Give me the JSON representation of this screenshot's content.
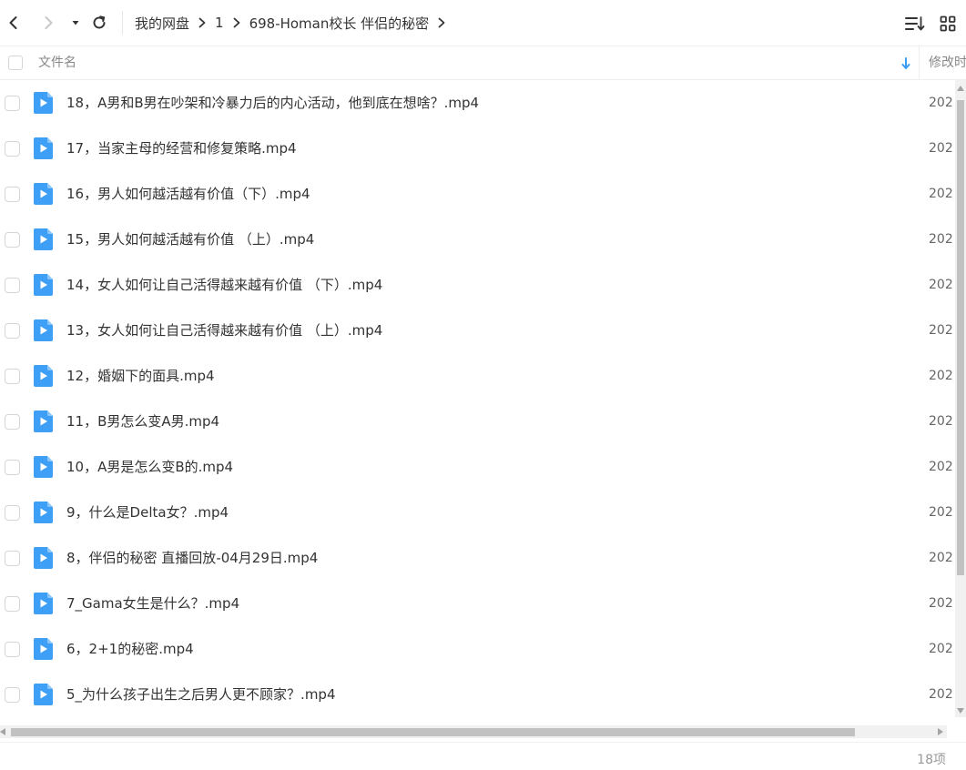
{
  "toolbar": {
    "back": "back-icon",
    "forward": "forward-icon",
    "history": "caret-down-icon",
    "refresh": "refresh-icon",
    "sort": "sort-list-icon",
    "view": "grid-view-icon"
  },
  "breadcrumb": [
    {
      "label": "我的网盘"
    },
    {
      "label": "1"
    },
    {
      "label": "698-Homan校长 伴侣的秘密"
    }
  ],
  "columns": {
    "name": "文件名",
    "modified": "修改时"
  },
  "files": [
    {
      "name": "18，A男和B男在吵架和冷暴力后的内心活动，他到底在想啥？.mp4",
      "modified": "202"
    },
    {
      "name": "17，当家主母的经营和修复策略.mp4",
      "modified": "202"
    },
    {
      "name": "16，男人如何越活越有价值（下）.mp4",
      "modified": "202"
    },
    {
      "name": "15，男人如何越活越有价值 （上）.mp4",
      "modified": "202"
    },
    {
      "name": "14，女人如何让自己活得越来越有价值 （下）.mp4",
      "modified": "202"
    },
    {
      "name": "13，女人如何让自己活得越来越有价值 （上）.mp4",
      "modified": "202"
    },
    {
      "name": "12，婚姻下的面具.mp4",
      "modified": "202"
    },
    {
      "name": "11，B男怎么变A男.mp4",
      "modified": "202"
    },
    {
      "name": "10，A男是怎么变B的.mp4",
      "modified": "202"
    },
    {
      "name": "9，什么是Delta女？.mp4",
      "modified": "202"
    },
    {
      "name": "8，伴侣的秘密 直播回放-04月29日.mp4",
      "modified": "202"
    },
    {
      "name": "7_Gama女生是什么？.mp4",
      "modified": "202"
    },
    {
      "name": "6，2+1的秘密.mp4",
      "modified": "202"
    },
    {
      "name": "5_为什么孩子出生之后男人更不顾家？.mp4",
      "modified": "202"
    }
  ],
  "footer": {
    "count": "18项"
  },
  "colors": {
    "accent": "#3b9cf5",
    "video_icon": "#3d9ff5"
  }
}
